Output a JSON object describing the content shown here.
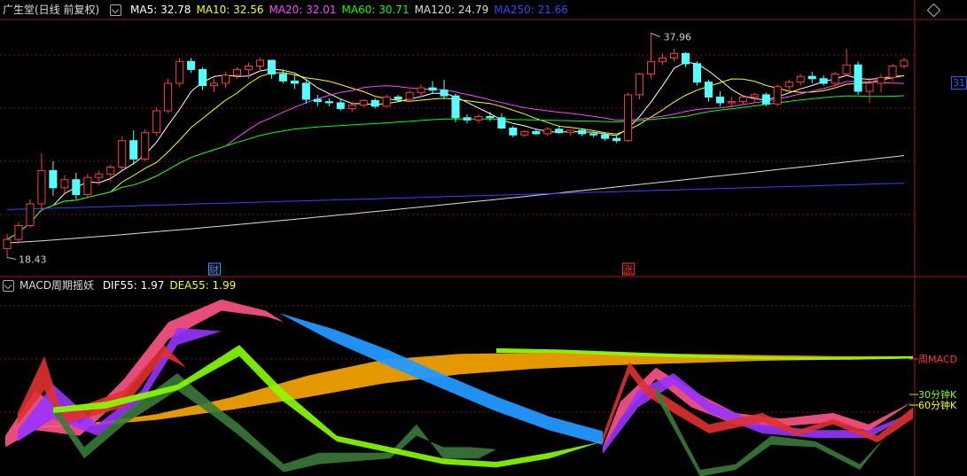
{
  "header": {
    "title": "广生堂(日线 前复权)",
    "indicators": [
      {
        "label": "MA5: 32.78",
        "color": "#ffffff"
      },
      {
        "label": "MA10: 32.56",
        "color": "#ffff00"
      },
      {
        "label": "MA20: 32.01",
        "color": "#ff44ff"
      },
      {
        "label": "MA60: 30.71",
        "color": "#00ff00"
      },
      {
        "label": "MA120: 24.79",
        "color": "#dddddd"
      },
      {
        "label": "MA250: 21.66",
        "color": "#3344ff"
      }
    ]
  },
  "sub_header": {
    "title": "MACD周期摇妖",
    "indicators": [
      {
        "label": "DIF55: 1.97",
        "color": "#ffffff"
      },
      {
        "label": "DEA55: 1.99",
        "color": "#ffff00"
      }
    ]
  },
  "annotations": {
    "high_label": "37.96",
    "low_label": "18.43",
    "price_tag": "31",
    "event_markers": [
      {
        "text": "财",
        "color": "#3399ff"
      },
      {
        "text": "涨",
        "color": "#ff3333"
      }
    ],
    "band_labels": [
      {
        "text": "周MACD",
        "color": "#ff3333"
      },
      {
        "text": "30分钟K",
        "color": "#88ff00"
      },
      {
        "text": "60分钟K",
        "color": "#ffff00"
      }
    ]
  },
  "colors": {
    "up": "#ff3b3b",
    "down": "#55ffff",
    "grid": "#7a1010",
    "orange_band": "#f0a000",
    "blue_band": "#2299ff"
  },
  "chart_data": {
    "type": "candlestick",
    "ohlc": [
      [
        19.2,
        20.5,
        18.43,
        20.0
      ],
      [
        20.0,
        21.5,
        19.6,
        21.2
      ],
      [
        21.2,
        23.5,
        21.0,
        23.1
      ],
      [
        23.1,
        27.5,
        22.5,
        26.0
      ],
      [
        26.0,
        26.8,
        23.8,
        24.5
      ],
      [
        24.5,
        25.6,
        24.0,
        25.2
      ],
      [
        25.2,
        25.8,
        23.5,
        23.9
      ],
      [
        23.9,
        25.7,
        23.7,
        25.4
      ],
      [
        25.4,
        26.0,
        24.7,
        25.7
      ],
      [
        25.7,
        26.5,
        25.0,
        26.3
      ],
      [
        26.3,
        29.0,
        26.0,
        28.6
      ],
      [
        28.6,
        29.5,
        26.5,
        27.0
      ],
      [
        27.0,
        29.6,
        26.8,
        29.3
      ],
      [
        29.3,
        31.5,
        29.0,
        31.2
      ],
      [
        31.2,
        34.0,
        31.0,
        33.6
      ],
      [
        33.6,
        35.8,
        33.3,
        35.5
      ],
      [
        35.5,
        35.8,
        34.5,
        34.8
      ],
      [
        34.8,
        35.0,
        33.0,
        33.4
      ],
      [
        33.4,
        34.0,
        32.8,
        33.6
      ],
      [
        33.6,
        34.6,
        33.2,
        34.3
      ],
      [
        34.3,
        35.0,
        34.0,
        34.8
      ],
      [
        34.8,
        35.4,
        34.0,
        35.1
      ],
      [
        35.1,
        35.8,
        34.6,
        35.6
      ],
      [
        35.6,
        35.6,
        34.0,
        34.4
      ],
      [
        34.4,
        34.8,
        33.6,
        33.8
      ],
      [
        33.8,
        34.3,
        33.1,
        33.6
      ],
      [
        33.6,
        33.9,
        31.8,
        32.2
      ],
      [
        32.2,
        32.6,
        31.6,
        32.0
      ],
      [
        32.0,
        32.3,
        31.6,
        31.9
      ],
      [
        31.9,
        32.2,
        31.2,
        31.4
      ],
      [
        31.4,
        32.0,
        31.1,
        31.7
      ],
      [
        31.7,
        32.2,
        31.5,
        32.1
      ],
      [
        32.1,
        32.3,
        31.4,
        31.6
      ],
      [
        31.6,
        32.6,
        31.5,
        32.4
      ],
      [
        32.4,
        32.6,
        32.0,
        32.2
      ],
      [
        32.2,
        33.0,
        32.0,
        32.8
      ],
      [
        32.8,
        33.5,
        32.4,
        33.2
      ],
      [
        33.2,
        33.8,
        32.7,
        33.0
      ],
      [
        33.0,
        33.9,
        32.2,
        32.5
      ],
      [
        32.5,
        32.7,
        30.2,
        30.6
      ],
      [
        30.6,
        30.9,
        30.1,
        30.4
      ],
      [
        30.4,
        30.9,
        30.1,
        30.7
      ],
      [
        30.7,
        31.1,
        30.3,
        30.6
      ],
      [
        30.6,
        31.0,
        29.6,
        29.7
      ],
      [
        29.7,
        29.9,
        28.9,
        29.1
      ],
      [
        29.1,
        29.5,
        28.9,
        29.4
      ],
      [
        29.4,
        29.6,
        29.1,
        29.2
      ],
      [
        29.2,
        29.8,
        29.0,
        29.6
      ],
      [
        29.6,
        29.9,
        29.2,
        29.3
      ],
      [
        29.3,
        29.6,
        29.0,
        29.5
      ],
      [
        29.5,
        29.7,
        29.0,
        29.2
      ],
      [
        29.2,
        29.4,
        28.9,
        29.1
      ],
      [
        29.1,
        29.3,
        28.6,
        28.8
      ],
      [
        28.8,
        29.0,
        28.4,
        28.6
      ],
      [
        28.6,
        32.8,
        28.5,
        32.6
      ],
      [
        32.6,
        34.5,
        32.2,
        34.4
      ],
      [
        34.4,
        37.96,
        34.0,
        35.5
      ],
      [
        35.5,
        36.2,
        35.2,
        35.8
      ],
      [
        35.8,
        36.6,
        35.5,
        36.2
      ],
      [
        36.2,
        36.3,
        35.0,
        35.3
      ],
      [
        35.3,
        35.5,
        33.4,
        33.7
      ],
      [
        33.7,
        33.9,
        32.0,
        32.4
      ],
      [
        32.4,
        32.9,
        31.6,
        31.9
      ],
      [
        31.9,
        32.4,
        31.5,
        32.0
      ],
      [
        32.0,
        32.6,
        31.7,
        32.4
      ],
      [
        32.4,
        32.8,
        32.0,
        32.6
      ],
      [
        32.6,
        32.8,
        31.6,
        31.8
      ],
      [
        31.8,
        33.5,
        31.6,
        33.3
      ],
      [
        33.3,
        33.9,
        33.0,
        33.7
      ],
      [
        33.7,
        34.4,
        33.4,
        34.2
      ],
      [
        34.2,
        34.6,
        33.6,
        34.0
      ],
      [
        34.0,
        34.3,
        33.4,
        33.6
      ],
      [
        33.6,
        34.6,
        33.3,
        34.4
      ],
      [
        34.4,
        36.6,
        34.2,
        35.2
      ],
      [
        35.2,
        35.5,
        32.6,
        32.9
      ],
      [
        32.9,
        34.1,
        31.9,
        33.6
      ],
      [
        33.6,
        34.4,
        32.8,
        34.1
      ],
      [
        34.1,
        35.3,
        33.8,
        35.1
      ],
      [
        35.1,
        35.8,
        34.9,
        35.6
      ]
    ],
    "ma_lines": [
      {
        "name": "MA5",
        "color": "#ffffff"
      },
      {
        "name": "MA10",
        "color": "#ffff00"
      },
      {
        "name": "MA20",
        "color": "#ff44ff"
      },
      {
        "name": "MA60",
        "color": "#00ff00"
      },
      {
        "name": "MA120",
        "color": "#dddddd"
      },
      {
        "name": "MA250",
        "color": "#3344ff"
      }
    ],
    "ma120_endpoints": [
      19.7,
      27.3
    ],
    "ma250_endpoints": [
      22.6,
      24.9
    ],
    "ylim": [
      18,
      39
    ],
    "macd_panel": {
      "bands": [
        {
          "name": "周MACD",
          "color": "#f0a000",
          "upper": [
            -4.3,
            -4.0,
            -3.1,
            -1.6,
            0.3,
            1.7,
            2.2,
            2.3,
            2.3,
            2.2,
            2.1,
            2.0,
            2.0
          ],
          "lower": [
            -4.3,
            -4.2,
            -3.6,
            -2.7,
            -1.6,
            -0.4,
            0.4,
            0.9,
            1.2,
            1.4,
            1.6,
            1.7,
            1.8
          ]
        },
        {
          "name": "band-blue",
          "color": "#2299ff",
          "upper": [
            5.8,
            4.4,
            2.6,
            0.5,
            -1.5,
            -3.3,
            -4.6
          ],
          "lower": [
            5.8,
            3.3,
            1.2,
            -0.8,
            -2.8,
            -4.5,
            -5.8
          ]
        },
        {
          "name": "band-green-right",
          "color": "#88ff00",
          "upper": [
            2.7,
            2.6,
            2.4,
            2.2,
            2.0,
            1.9,
            1.9,
            2.0
          ],
          "lower": [
            2.3,
            2.3,
            2.1,
            1.9,
            1.8,
            1.7,
            1.7,
            1.8
          ]
        }
      ]
    }
  }
}
